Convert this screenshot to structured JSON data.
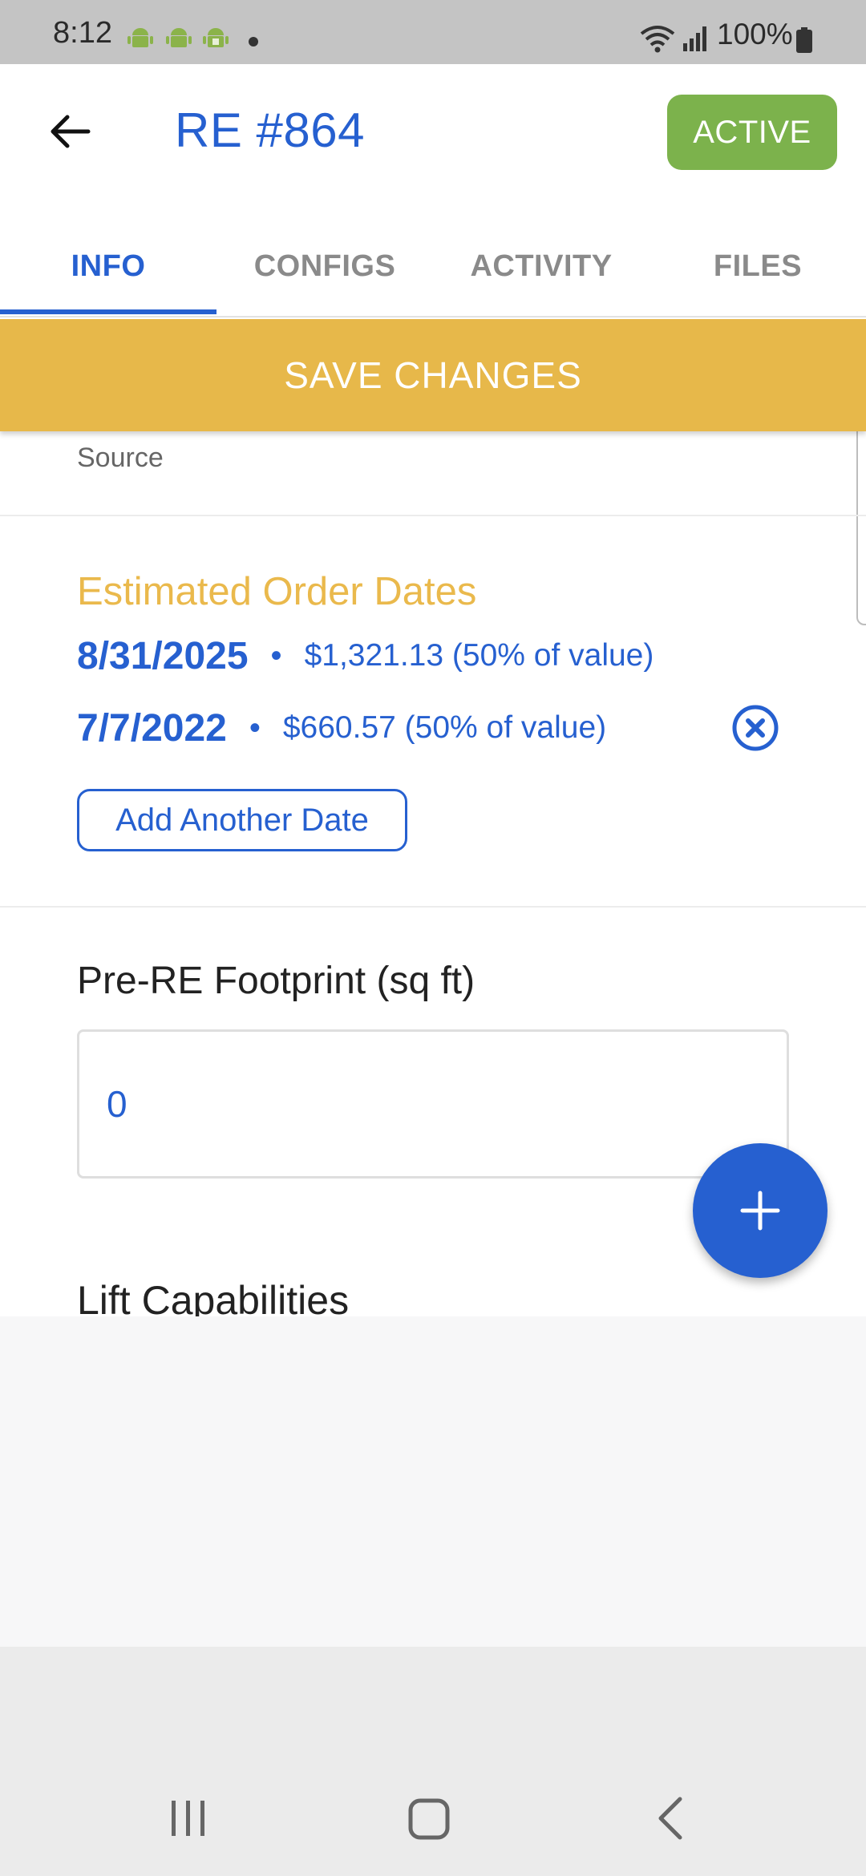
{
  "status_bar": {
    "time": "8:12",
    "battery": "100%",
    "icons": [
      "android-icon",
      "android-icon",
      "android-icon",
      "dot-icon",
      "wifi-icon",
      "signal-icon",
      "battery-icon"
    ]
  },
  "app_bar": {
    "back_icon": "arrow-left-icon",
    "title": "RE #864",
    "status_badge": "ACTIVE"
  },
  "tabs": [
    {
      "label": "INFO",
      "active": true
    },
    {
      "label": "CONFIGS",
      "active": false
    },
    {
      "label": "ACTIVITY",
      "active": false
    },
    {
      "label": "FILES",
      "active": false
    }
  ],
  "save_changes": "SAVE CHANGES",
  "partial_field": {
    "source_text": "Source"
  },
  "order_dates": {
    "heading": "Estimated Order Dates",
    "rows": [
      {
        "date": "8/31/2025",
        "amount": "$1,321.13 (50% of value)",
        "removable": false
      },
      {
        "date": "7/7/2022",
        "amount": "$660.57 (50% of value)",
        "removable": true
      }
    ],
    "separator": "•",
    "add_button": "Add Another Date"
  },
  "footprint": {
    "label": "Pre-RE Footprint (sq ft)",
    "value": "0"
  },
  "lift": {
    "label": "Lift Capabilities"
  },
  "fab_icon": "plus-icon",
  "nav_bar": {
    "icons": [
      "recents-icon",
      "home-icon",
      "back-icon"
    ]
  },
  "colors": {
    "primary": "#2660d0",
    "accent_yellow": "#e7b84a",
    "active_green": "#7cb24c"
  }
}
